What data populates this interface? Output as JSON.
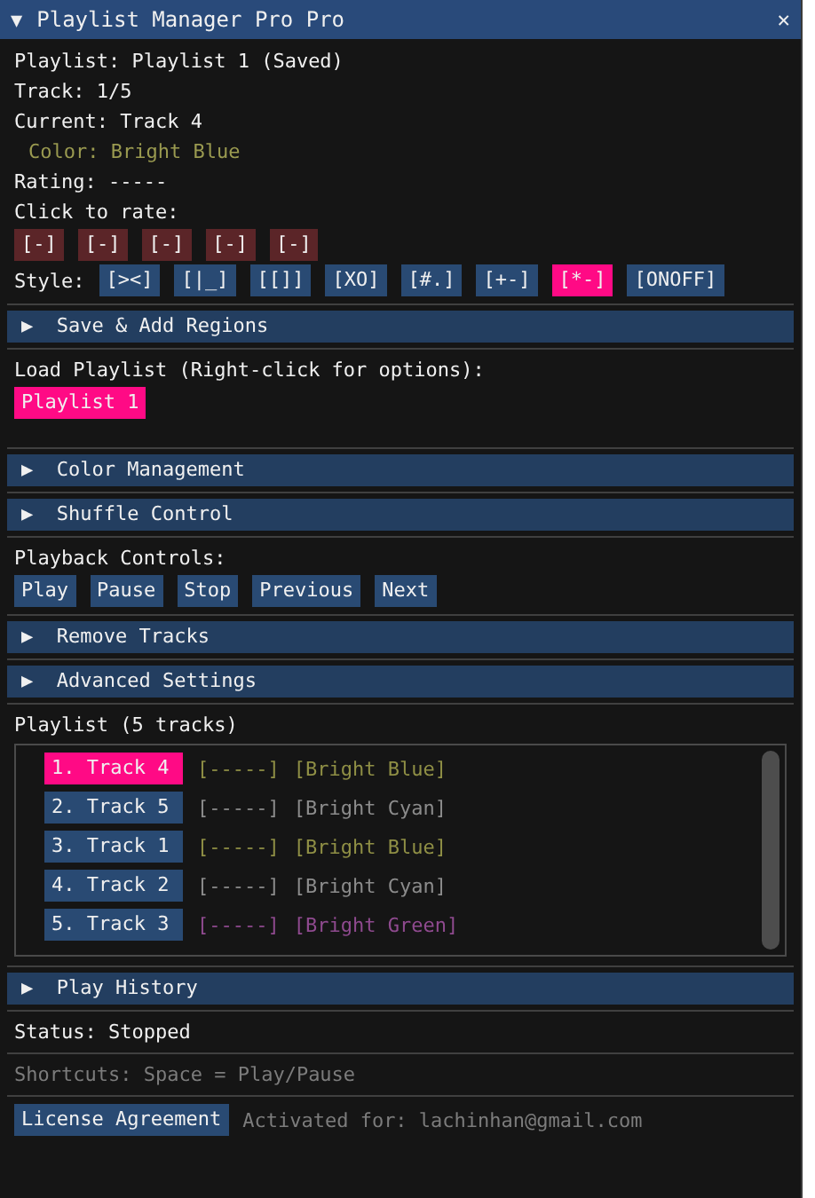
{
  "window": {
    "title": "Playlist Manager Pro Pro",
    "collapse_glyph": "▼",
    "close_glyph": "✕"
  },
  "info": {
    "playlist": "Playlist: Playlist 1 (Saved)",
    "track": "Track: 1/5",
    "current": "Current: Track 4",
    "color_label": "Color: Bright Blue",
    "rating": "Rating: -----"
  },
  "rate": {
    "label": "Click to rate:",
    "buttons": [
      "[-]",
      "[-]",
      "[-]",
      "[-]",
      "[-]"
    ]
  },
  "style": {
    "label": "Style:",
    "options": [
      {
        "label": "[><]",
        "selected": false
      },
      {
        "label": "[|_]",
        "selected": false
      },
      {
        "label": "[[]]",
        "selected": false
      },
      {
        "label": "[XO]",
        "selected": false
      },
      {
        "label": "[#.]",
        "selected": false
      },
      {
        "label": "[+-]",
        "selected": false
      },
      {
        "label": "[*-]",
        "selected": true
      },
      {
        "label": "[ONOFF]",
        "selected": false
      }
    ]
  },
  "sections": [
    {
      "kind": "header",
      "label": "Save & Add Regions",
      "glyph": "▶"
    },
    {
      "kind": "load",
      "label": "Load Playlist (Right-click for options):",
      "playlists": [
        {
          "label": "Playlist 1",
          "selected": true
        }
      ]
    },
    {
      "kind": "header",
      "label": "Color Management",
      "glyph": "▶"
    },
    {
      "kind": "header",
      "label": "Shuffle Control",
      "glyph": "▶"
    },
    {
      "kind": "playback",
      "label": "Playback Controls:",
      "buttons": [
        "Play",
        "Pause",
        "Stop",
        "Previous",
        "Next"
      ]
    },
    {
      "kind": "header",
      "label": "Remove Tracks",
      "glyph": "▶"
    },
    {
      "kind": "header",
      "label": "Advanced Settings",
      "glyph": "▶"
    },
    {
      "kind": "tracks",
      "label": "Playlist (5 tracks)",
      "tracks": [
        {
          "name": "1. Track 4",
          "rating": "[-----]",
          "color_name": "[Bright Blue]",
          "color": "#8f8f45",
          "selected": true
        },
        {
          "name": "2. Track 5",
          "rating": "[-----]",
          "color_name": "[Bright Cyan]",
          "color": "#8c8c8c",
          "selected": false
        },
        {
          "name": "3. Track 1",
          "rating": "[-----]",
          "color_name": "[Bright Blue]",
          "color": "#8f8f45",
          "selected": false
        },
        {
          "name": "4. Track 2",
          "rating": "[-----]",
          "color_name": "[Bright Cyan]",
          "color": "#8c8c8c",
          "selected": false
        },
        {
          "name": "5. Track 3",
          "rating": "[-----]",
          "color_name": "[Bright Green]",
          "color": "#8f4a8f",
          "selected": false
        }
      ]
    },
    {
      "kind": "header",
      "label": "Play History",
      "glyph": "▶"
    }
  ],
  "status": "Status: Stopped",
  "shortcuts": "Shortcuts: Space = Play/Pause",
  "footer": {
    "license_button": "License Agreement",
    "activated": "Activated for: lachinhan@gmail.com"
  }
}
